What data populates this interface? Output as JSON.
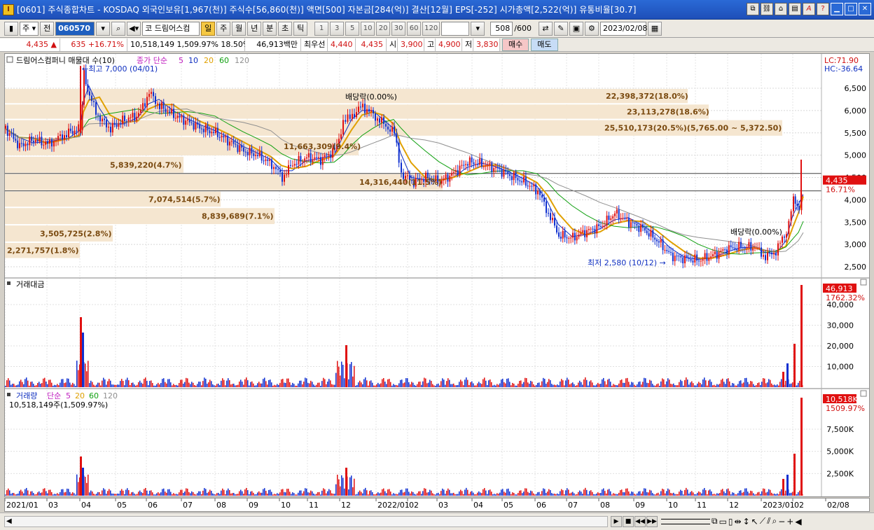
{
  "window": {
    "title": "[0601] 주식종합차트 - KOSDAQ 외국인보유[1,967(천)] 주식수[56,860(천)] 액면[500] 자본금[284(억)] 결산[12월] EPS[-252] 시가총액[2,522(억)] 유통비율[30.7]",
    "icon": "chart-app-icon",
    "buttons": [
      "restore-icon",
      "link-icon",
      "home-icon",
      "print-icon",
      "text-a-icon",
      "help-icon",
      "minimize-icon",
      "maximize-icon",
      "close-icon"
    ]
  },
  "toolbar": {
    "period_select": "주",
    "prev_label": "전",
    "code_value": "060570",
    "stock_name": "드림어스컴",
    "stock_prefix": "코",
    "period_tabs": [
      "일",
      "주",
      "월",
      "년",
      "분",
      "초",
      "틱"
    ],
    "active_period": "일",
    "interval_buttons": [
      "1",
      "3",
      "5",
      "10",
      "20",
      "30",
      "60",
      "120"
    ],
    "count_value": "508",
    "count_total": "/600",
    "date_value": "2023/02/08"
  },
  "quote": {
    "price": "4,435",
    "price_arrow": "▲",
    "change": "635",
    "change_pct": "+16.71%",
    "volume": "10,518,149",
    "volume_pct": "1,509.97%",
    "turnover": "18.50%",
    "amount": "46,913백만",
    "best_ask_label": "최우선",
    "ask1": "4,440",
    "bid1": "4,435",
    "open_label": "시",
    "open": "3,900",
    "high_label": "고",
    "high": "4,900",
    "low_label": "저",
    "low": "3,830",
    "buy_label": "매수",
    "sell_label": "매도"
  },
  "price_panel": {
    "legend_name": "드림어스컴퍼니 매물대 수(10)",
    "legend_ma": "종가 단순",
    "ma_periods": [
      "5",
      "10",
      "20",
      "60",
      "120"
    ],
    "ma_colors": [
      "#c020c0",
      "#1030c0",
      "#e0a000",
      "#10a010",
      "#909090"
    ],
    "lc_label": "LC:71.90",
    "hc_label": "HC:-36.64",
    "price_ticks": [
      "6,500",
      "6,000",
      "5,500",
      "5,000",
      "4,500",
      "4,000",
      "3,500",
      "3,000",
      "2,500"
    ],
    "last_price_tag": "4,435",
    "last_pct_tag": "16.71%",
    "high_annotation": "최고 7,000 (04/01)",
    "low_annotation": "최저 2,580 (10/12)",
    "dividend1": "배당락(0.00%)",
    "dividend2": "배당락(0.00%)",
    "volume_profile": [
      "22,398,372(18.0%)",
      "23,113,278(18.6%)",
      "25,510,173(20.5%)(5,765.00 ~ 5,372.50)",
      "11,663,309(9.4%)",
      "5,839,220(4.7%)",
      "14,316,440(11.5%)",
      "7,074,514(5.7%)",
      "8,839,689(7.1%)",
      "3,505,725(2.8%)",
      "2,271,757(1.8%)"
    ]
  },
  "amount_panel": {
    "legend": "거래대금",
    "ticks": [
      "40,000",
      "30,000",
      "20,000",
      "10,000"
    ],
    "last_tag": "46,913",
    "last_pct": "1762.32%"
  },
  "volume_panel": {
    "legend_name": "거래량",
    "legend_ma": "단순",
    "ma_periods": [
      "5",
      "20",
      "60",
      "120"
    ],
    "value_text": "10,518,149주(1,509.97%)",
    "ticks": [
      "7,500K",
      "5,000K",
      "2,500K"
    ],
    "last_tag": "10,518K",
    "last_pct": "1509.97%"
  },
  "x_axis": {
    "labels": [
      "2021/01",
      "03",
      "04",
      "05",
      "06",
      "07",
      "08",
      "09",
      "10",
      "11",
      "12",
      "2022/01",
      "02",
      "03",
      "04",
      "05",
      "06",
      "07",
      "08",
      "09",
      "10",
      "11",
      "12",
      "2023/01",
      "02",
      "02/08"
    ]
  },
  "colors": {
    "up": "#e01010",
    "down": "#1030d0",
    "profile": "#f5e6d0",
    "profile_text": "#7a4a10"
  }
}
